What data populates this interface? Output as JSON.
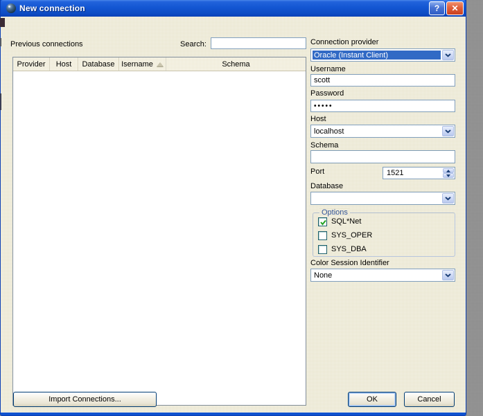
{
  "window": {
    "title": "New connection",
    "help_button": "?",
    "close_button": "✕"
  },
  "left_panel": {
    "previous_connections_label": "Previous connections",
    "search_label": "Search:",
    "search_value": "",
    "table": {
      "columns": [
        "Provider",
        "Host",
        "Database",
        "Isername",
        "Schema"
      ],
      "sorted_column": "Isername",
      "sort_direction": "ascending",
      "rows": []
    },
    "import_button_label": "Import Connections..."
  },
  "right_panel": {
    "connection_provider": {
      "label": "Connection provider",
      "value": "Oracle (Instant Client)"
    },
    "username": {
      "label": "Username",
      "value": "scott"
    },
    "password": {
      "label": "Password",
      "value": "•••••"
    },
    "host": {
      "label": "Host",
      "value": "localhost"
    },
    "schema": {
      "label": "Schema",
      "value": ""
    },
    "port": {
      "label": "Port",
      "value": "1521"
    },
    "database": {
      "label": "Database",
      "value": ""
    },
    "options": {
      "label": "Options",
      "checkboxes": [
        {
          "label": "SQL*Net",
          "checked": true
        },
        {
          "label": "SYS_OPER",
          "checked": false
        },
        {
          "label": "SYS_DBA",
          "checked": false
        }
      ]
    },
    "color_session_identifier": {
      "label": "Color Session Identifier",
      "value": "None"
    }
  },
  "footer": {
    "ok_label": "OK",
    "cancel_label": "Cancel"
  },
  "colors": {
    "titlebar_blue": "#1356d2",
    "window_border": "#0f52cf",
    "dialog_face": "#ece9d8",
    "input_border": "#7f9db9",
    "selection_blue": "#316ac5",
    "close_button_red": "#e0603a",
    "groupbox_label_blue": "#35569b",
    "check_green": "#21a121",
    "desktop_gray": "#919191"
  }
}
